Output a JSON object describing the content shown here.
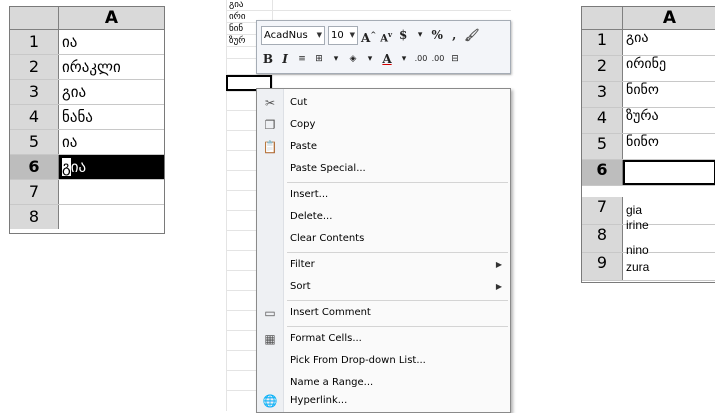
{
  "left_sheet": {
    "column": "A",
    "rows": [
      {
        "n": "1",
        "value": "ია"
      },
      {
        "n": "2",
        "value": "ირაკლი"
      },
      {
        "n": "3",
        "value": "გია"
      },
      {
        "n": "4",
        "value": "ნანა"
      },
      {
        "n": "5",
        "value": "ია"
      },
      {
        "n": "6",
        "value_first": "გ",
        "value_rest": "ია"
      },
      {
        "n": "7",
        "value": ""
      },
      {
        "n": "8",
        "value": ""
      }
    ]
  },
  "mid_sheet": {
    "cells": [
      "გია",
      "ირი",
      "ნინ",
      "ზურ"
    ],
    "mini_toolbar": {
      "font": "AcadNus",
      "size": "10",
      "grow_font": "A",
      "shrink_font": "A",
      "currency": "$",
      "percent": "%",
      "comma": ",",
      "bold": "B",
      "italic": "I",
      "font_color": "A",
      "inc_decimal": ".00",
      "dec_decimal": ".00"
    },
    "context_menu": [
      {
        "label": "Cut",
        "icon": "scissors-icon",
        "glyph": "✂"
      },
      {
        "label": "Copy",
        "icon": "copy-icon",
        "glyph": "❐"
      },
      {
        "label": "Paste",
        "icon": "paste-icon",
        "glyph": "📋"
      },
      {
        "label": "Paste Special...",
        "icon": "",
        "glyph": ""
      },
      {
        "label": "Insert...",
        "icon": "",
        "glyph": ""
      },
      {
        "label": "Delete...",
        "icon": "",
        "glyph": ""
      },
      {
        "label": "Clear Contents",
        "icon": "",
        "glyph": ""
      },
      {
        "label": "Filter",
        "icon": "",
        "glyph": "",
        "submenu": true
      },
      {
        "label": "Sort",
        "icon": "",
        "glyph": "",
        "submenu": true
      },
      {
        "label": "Insert Comment",
        "icon": "comment-icon",
        "glyph": "▭"
      },
      {
        "label": "Format Cells...",
        "icon": "format-cells-icon",
        "glyph": "▦"
      },
      {
        "label": "Pick From Drop-down List...",
        "icon": "",
        "glyph": ""
      },
      {
        "label": "Name a Range...",
        "icon": "",
        "glyph": ""
      },
      {
        "label": "Hyperlink...",
        "icon": "hyperlink-icon",
        "glyph": "🌐"
      }
    ]
  },
  "right_sheet": {
    "column": "A",
    "rows": [
      {
        "n": "1",
        "value": "გია"
      },
      {
        "n": "2",
        "value": "ირინე"
      },
      {
        "n": "3",
        "value": "ნინო"
      },
      {
        "n": "4",
        "value": "ზურა"
      },
      {
        "n": "5",
        "value": "ნინო"
      },
      {
        "n": "6",
        "value": ""
      },
      {
        "n": "7",
        "value": ""
      },
      {
        "n": "8",
        "value": ""
      },
      {
        "n": "9",
        "value": ""
      }
    ],
    "lower_text": [
      "gia",
      "irine",
      "nino",
      "zura"
    ]
  }
}
